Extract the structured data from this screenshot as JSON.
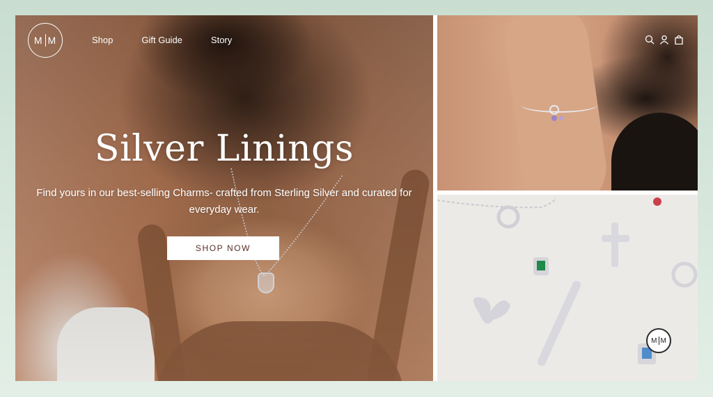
{
  "brand": {
    "logo_left": "M",
    "logo_right": "M"
  },
  "nav": {
    "links": [
      {
        "label": "Shop"
      },
      {
        "label": "Gift Guide"
      },
      {
        "label": "Story"
      }
    ],
    "icons": [
      "search-icon",
      "account-icon",
      "bag-icon"
    ]
  },
  "hero": {
    "title": "Silver Linings",
    "subtitle": "Find yours in our best-selling Charms- crafted from Sterling Silver and curated for everyday wear.",
    "cta_label": "SHOP NOW"
  },
  "chat": {
    "logo_left": "M",
    "logo_right": "M"
  },
  "colors": {
    "cta_text": "#5a2f22",
    "page_bg": "#d9e7dc"
  }
}
